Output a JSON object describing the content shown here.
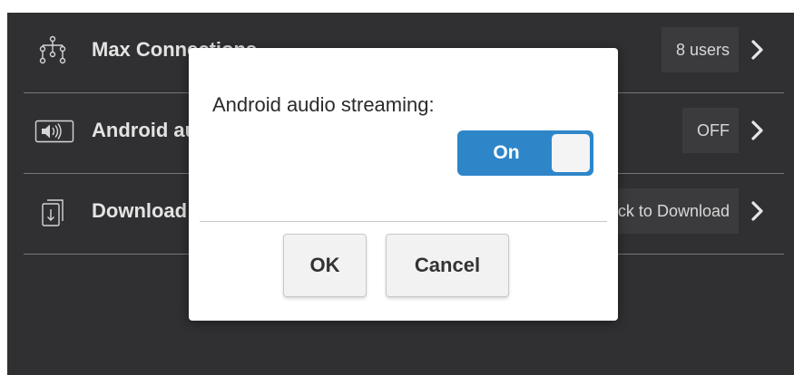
{
  "settings": {
    "rows": [
      {
        "label": "Max Connections",
        "value": "8 users",
        "icon": "network-tree-icon"
      },
      {
        "label": "Android audio streaming",
        "value": "OFF",
        "icon": "speaker-icon"
      },
      {
        "label": "Download",
        "value": "Click to Download",
        "icon": "download-icon"
      }
    ]
  },
  "dialog": {
    "message": "Android audio streaming:",
    "toggle_label": "On",
    "toggle_state": "on",
    "ok_label": "OK",
    "cancel_label": "Cancel"
  },
  "colors": {
    "screen_background": "#303033",
    "toggle_on": "#2e86c9",
    "dialog_background": "#ffffff"
  }
}
